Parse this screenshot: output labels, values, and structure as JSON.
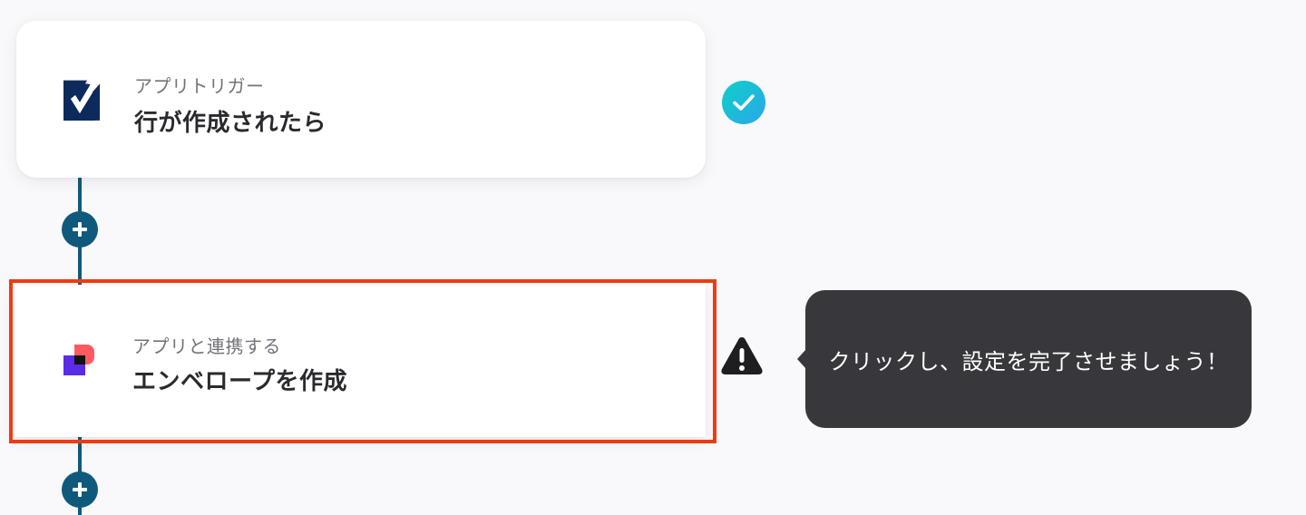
{
  "flow": {
    "trigger": {
      "subtitle": "アプリトリガー",
      "title": "行が作成されたら",
      "app_icon": "smartsheet-icon",
      "status": "completed"
    },
    "action": {
      "subtitle": "アプリと連携する",
      "title": "エンベロープを作成",
      "app_icon": "docusign-style-app-icon",
      "status": "warning",
      "highlighted": true
    },
    "add_step_icon": "plus-icon"
  },
  "tooltip": {
    "text": "クリックし、設定を完了させましょう！"
  },
  "colors": {
    "background": "#f9f8fb",
    "connector": "#0f5a7c",
    "highlight_border": "#ee3b12",
    "check_gradient_start": "#0fd0c8",
    "check_gradient_end": "#2aa6ea",
    "tooltip_bg": "#38373c",
    "warning": "#1e1e22"
  }
}
